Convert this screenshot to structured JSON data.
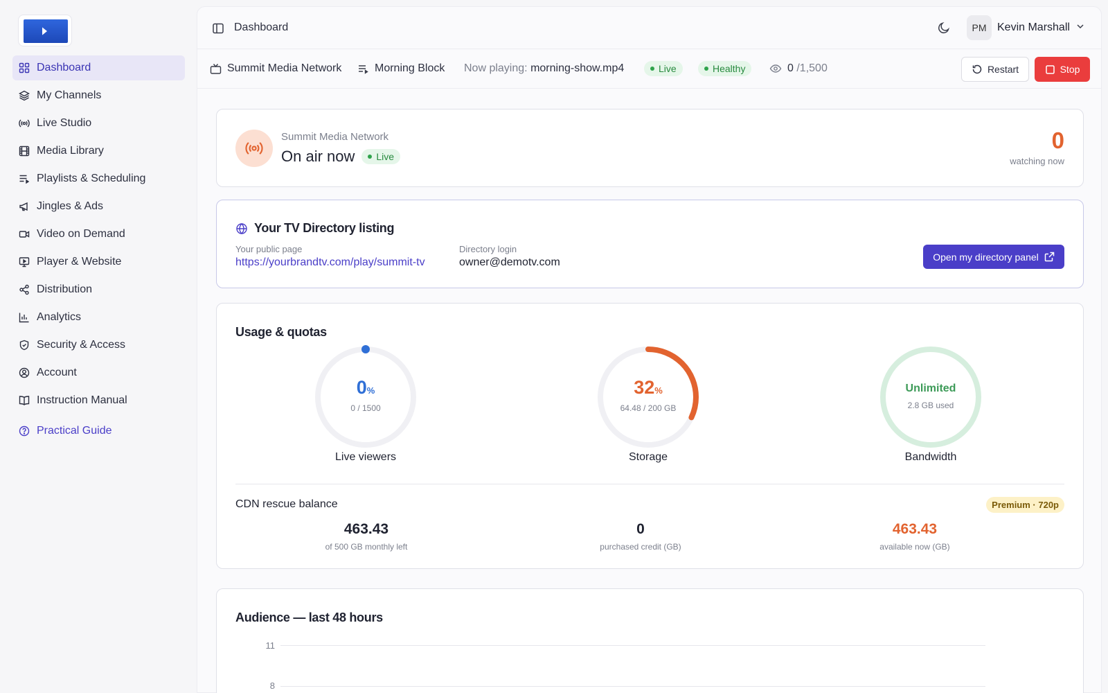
{
  "sidebar": {
    "items": [
      {
        "label": "Dashboard",
        "icon": "grid-icon"
      },
      {
        "label": "My Channels",
        "icon": "layers-icon"
      },
      {
        "label": "Live Studio",
        "icon": "broadcast-icon"
      },
      {
        "label": "Media Library",
        "icon": "film-icon"
      },
      {
        "label": "Playlists & Scheduling",
        "icon": "playlist-icon"
      },
      {
        "label": "Jingles & Ads",
        "icon": "megaphone-icon"
      },
      {
        "label": "Video on Demand",
        "icon": "video-icon"
      },
      {
        "label": "Player & Website",
        "icon": "monitor-play-icon"
      },
      {
        "label": "Distribution",
        "icon": "share-icon"
      },
      {
        "label": "Analytics",
        "icon": "bar-chart-icon"
      },
      {
        "label": "Security & Access",
        "icon": "shield-icon"
      },
      {
        "label": "Account",
        "icon": "user-circle-icon"
      },
      {
        "label": "Instruction Manual",
        "icon": "book-icon"
      }
    ],
    "guide_label": "Practical Guide"
  },
  "header": {
    "title": "Dashboard",
    "user_initials": "PM",
    "user_name": "Kevin Marshall"
  },
  "statusbar": {
    "network": "Summit Media Network",
    "block": "Morning Block",
    "now_playing_label": "Now playing:",
    "now_playing_file": "morning-show.mp4",
    "live_label": "Live",
    "health_label": "Healthy",
    "viewers": "0",
    "viewer_cap": "/1,500",
    "restart_label": "Restart",
    "stop_label": "Stop"
  },
  "onair": {
    "network": "Summit Media Network",
    "title": "On air now",
    "live_label": "Live",
    "watching_count": "0",
    "watching_label": "watching now"
  },
  "directory": {
    "title": "Your TV Directory listing",
    "public_label": "Your public page",
    "public_url": "https://yourbrandtv.com/play/summit-tv",
    "login_label": "Directory login",
    "login_value": "owner@demotv.com",
    "button_label": "Open my directory panel"
  },
  "usage": {
    "title": "Usage & quotas",
    "viewers": {
      "value": "0",
      "unit": "%",
      "sub": "0 / 1500",
      "label": "Live viewers",
      "fraction": 0,
      "color": "#2f6fd6"
    },
    "storage": {
      "value": "32",
      "unit": "%",
      "sub": "64.48 / 200 GB",
      "label": "Storage",
      "fraction": 0.32,
      "color": "#e2632f"
    },
    "bandwidth": {
      "value": "Unlimited",
      "sub": "2.8 GB used",
      "label": "Bandwidth",
      "color": "#3c9a57"
    },
    "cdn_title": "CDN rescue balance",
    "plan_badge": "Premium · 720p",
    "cdn": [
      {
        "value": "463.43",
        "label": "of 500 GB monthly left",
        "color": "#1f2230"
      },
      {
        "value": "0",
        "label": "purchased credit (GB)",
        "color": "#1f2230"
      },
      {
        "value": "463.43",
        "label": "available now (GB)",
        "color": "#e2632f"
      }
    ]
  },
  "audience": {
    "title": "Audience — last 48 hours",
    "ticks": [
      "11",
      "8"
    ]
  }
}
